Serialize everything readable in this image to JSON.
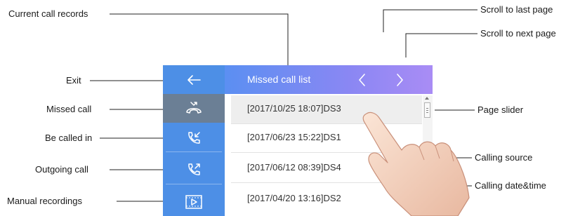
{
  "callouts": {
    "current_call_records": "Current call records",
    "scroll_last_page": "Scroll to last page",
    "scroll_next_page": "Scroll to next page",
    "exit": "Exit",
    "missed_call": "Missed call",
    "be_called_in": "Be called in",
    "outgoing_call": "Outgoing call",
    "manual_recordings": "Manual recordings",
    "page_slider": "Page slider",
    "calling_source": "Calling source",
    "calling_date_time": "Calling date&time"
  },
  "screen": {
    "header_title": "Missed call list",
    "records": [
      {
        "datetime": "[2017/10/25  18:07]",
        "source": "DS3"
      },
      {
        "datetime": "[2017/06/23  15:22]",
        "source": "DS1"
      },
      {
        "datetime": "[2017/06/12  08:39]",
        "source": "DS4"
      },
      {
        "datetime": "[2017/04/20  13:16]",
        "source": "DS2"
      }
    ]
  },
  "icons": {
    "exit": "arrow-left-icon",
    "missed_call": "missed-call-icon",
    "be_called_in": "incoming-call-icon",
    "outgoing_call": "outgoing-call-icon",
    "manual_recordings": "video-recording-icon",
    "prev_page": "chevron-left-icon",
    "next_page": "chevron-right-icon"
  },
  "colors": {
    "sidebar": "#4d8fe6",
    "active_item": "#6b7f95",
    "header_start": "#5b8ff2",
    "header_end": "#a98cf5"
  }
}
